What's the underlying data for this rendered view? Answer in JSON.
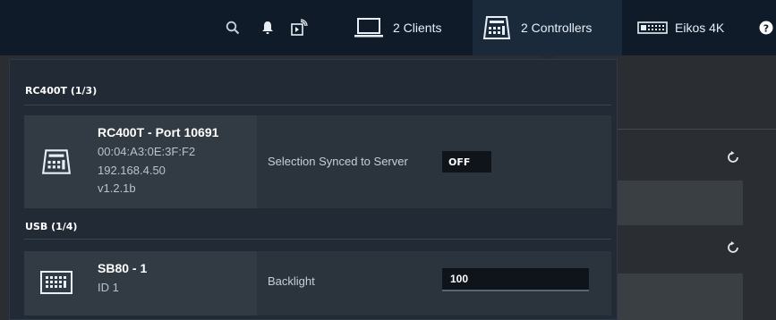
{
  "topbar": {
    "search_icon": "search-icon",
    "bell_icon": "bell-icon",
    "cast_icon": "cast-icon",
    "clients_label": "2 Clients",
    "controllers_label": "2 Controllers",
    "display_label": "Eikos 4K",
    "help_icon": "help-icon"
  },
  "dropdown": {
    "sections": [
      {
        "title": "RC400T (1/3)",
        "device": {
          "name": "RC400T - Port 10691",
          "mac": "00:04:A3:0E:3F:F2",
          "ip": "192.168.4.50",
          "version": "v1.2.1b",
          "property_label": "Selection Synced to Server",
          "property_value": "OFF"
        }
      },
      {
        "title": "USB (1/4)",
        "device": {
          "name": "SB80 - 1",
          "id": "ID 1",
          "property_label": "Backlight",
          "property_value": "100"
        }
      }
    ]
  },
  "colors": {
    "topbar_bg": "#101b2a",
    "dropdown_bg": "#222b35",
    "device_bg": "#2b333d",
    "input_bg": "#0f141a"
  }
}
